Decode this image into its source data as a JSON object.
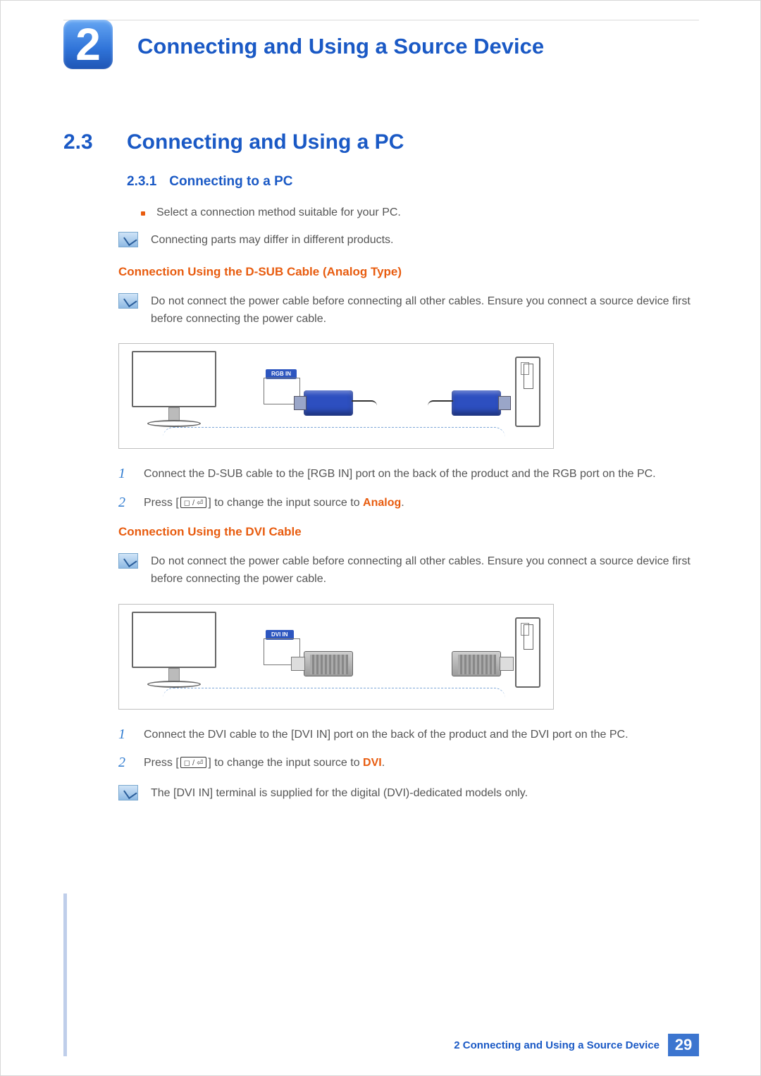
{
  "chapter": {
    "number": "2",
    "title": "Connecting and Using a Source Device"
  },
  "section": {
    "number": "2.3",
    "title": "Connecting and Using a PC"
  },
  "subsection": {
    "number": "2.3.1",
    "title": "Connecting to a PC"
  },
  "bullet1": "Select a connection method suitable for your PC.",
  "note1": "Connecting parts may differ in different products.",
  "dsub": {
    "heading": "Connection Using the D-SUB Cable (Analog Type)",
    "warning": "Do not connect the power cable before connecting all other cables. Ensure you connect a source device first before connecting the power cable.",
    "port_label": "RGB IN",
    "step1": "Connect the D-SUB cable to the [RGB IN] port on the back of the product and the RGB port on the PC.",
    "step2a": "Press [",
    "step2b": "] to change the input source to ",
    "step2_target": "Analog",
    "step2_end": "."
  },
  "dvi": {
    "heading": "Connection Using the DVI Cable",
    "warning": "Do not connect the power cable before connecting all other cables. Ensure you connect a source device first before connecting the power cable.",
    "port_label": "DVI IN",
    "step1": "Connect the DVI cable to the [DVI IN] port on the back of the product and the DVI port on the PC.",
    "step2a": "Press [",
    "step2b": "] to change the input source to ",
    "step2_target": "DVI",
    "step2_end": ".",
    "note": "The [DVI IN] terminal is supplied for the digital (DVI)-dedicated models only."
  },
  "steps_numbers": {
    "one": "1",
    "two": "2"
  },
  "source_button_glyph": "◻ / ⏎",
  "footer": {
    "text": "2 Connecting and Using a Source Device",
    "page": "29"
  }
}
